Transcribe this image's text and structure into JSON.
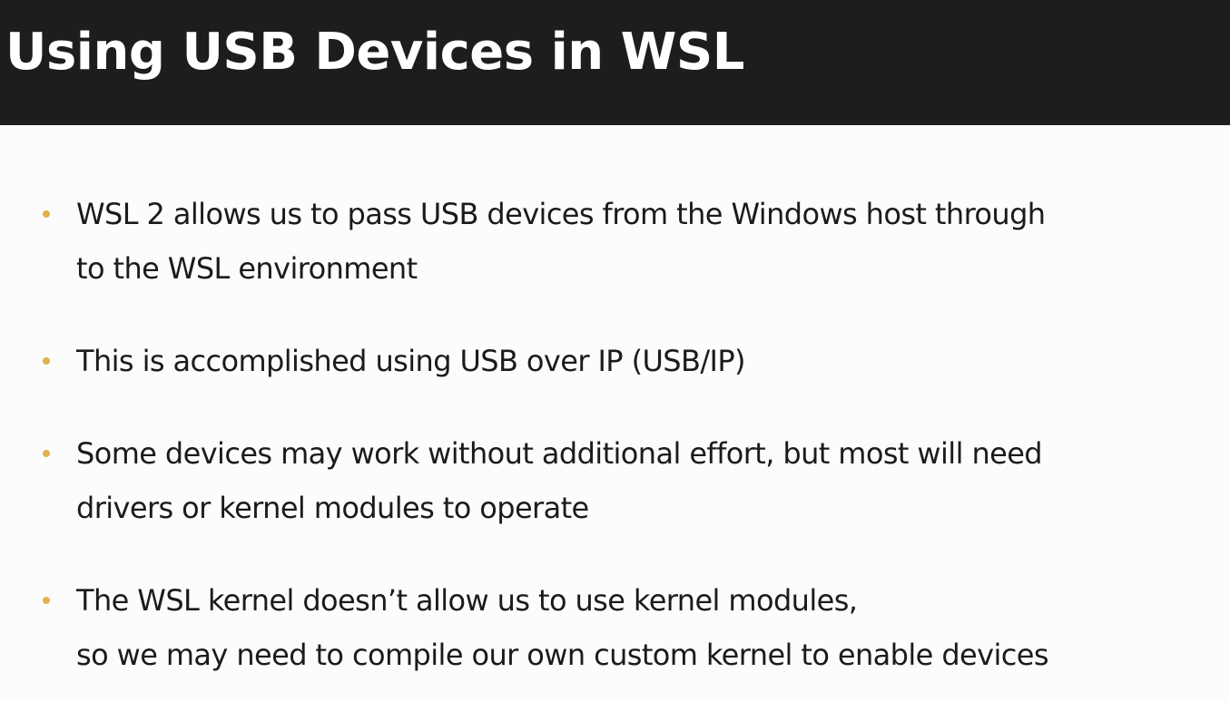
{
  "slide": {
    "title": "Using USB Devices in WSL",
    "bullet_color": "#e0b24a",
    "header_background": "#1e1c1c",
    "bullets": [
      {
        "line1": "WSL 2 allows us to pass USB devices from the Windows host through",
        "line2": "to the WSL environment"
      },
      {
        "line1": "This is accomplished using USB over IP (USB/IP)"
      },
      {
        "line1": "Some devices may work without additional effort, but most will need",
        "line2": "drivers or kernel modules to operate"
      },
      {
        "line1": "The WSL kernel doesn’t allow us to use kernel modules,",
        "line2": "so we may need to compile our own custom kernel to enable devices"
      }
    ]
  }
}
